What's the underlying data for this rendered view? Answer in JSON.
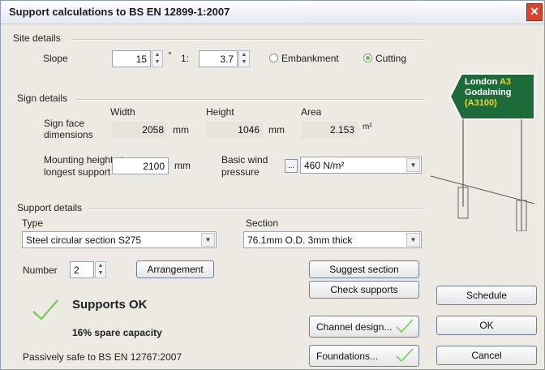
{
  "window": {
    "title": "Support calculations to BS EN 12899-1:2007",
    "close_icon": "close-icon"
  },
  "site": {
    "heading": "Site details",
    "slope_label": "Slope",
    "slope_degrees": "15",
    "degree_symbol": "°",
    "ratio_prefix": "1:",
    "ratio_value": "3.7",
    "embankment_label": "Embankment",
    "cutting_label": "Cutting",
    "selected": "Cutting"
  },
  "sign": {
    "heading": "Sign details",
    "face_label": "Sign face dimensions",
    "width_label": "Width",
    "width_value": "2058",
    "width_unit": "mm",
    "height_label": "Height",
    "height_value": "1046",
    "height_unit": "mm",
    "area_label": "Area",
    "area_value": "2.153",
    "area_unit": "m²",
    "mounting_label": "Mounting height at longest support",
    "mounting_value": "2100",
    "mounting_unit": "mm",
    "wind_label": "Basic wind pressure",
    "wind_button": "...",
    "wind_value": "460 N/m²"
  },
  "support": {
    "heading": "Support details",
    "type_label": "Type",
    "type_value": "Steel circular section S275",
    "section_label": "Section",
    "section_value": "76.1mm O.D. 3mm thick",
    "number_label": "Number",
    "number_value": "2",
    "arrangement_button": "Arrangement",
    "suggest_button": "Suggest section",
    "check_button": "Check supports",
    "status_text": "Supports OK",
    "spare_text": "16% spare capacity",
    "passive_text": "Passively safe to BS EN 12767:2007"
  },
  "buttons": {
    "channel": "Channel design...",
    "foundations": "Foundations...",
    "schedule": "Schedule",
    "ok": "OK",
    "cancel": "Cancel"
  },
  "road_sign": {
    "line1": "London",
    "route": "A3",
    "line2": "Godalming",
    "line3": "(A3100)",
    "bg_color": "#1e6b3a",
    "route_color": "#f5d21b"
  },
  "colors": {
    "accent": "#5fb84b",
    "close": "#d9442c"
  }
}
